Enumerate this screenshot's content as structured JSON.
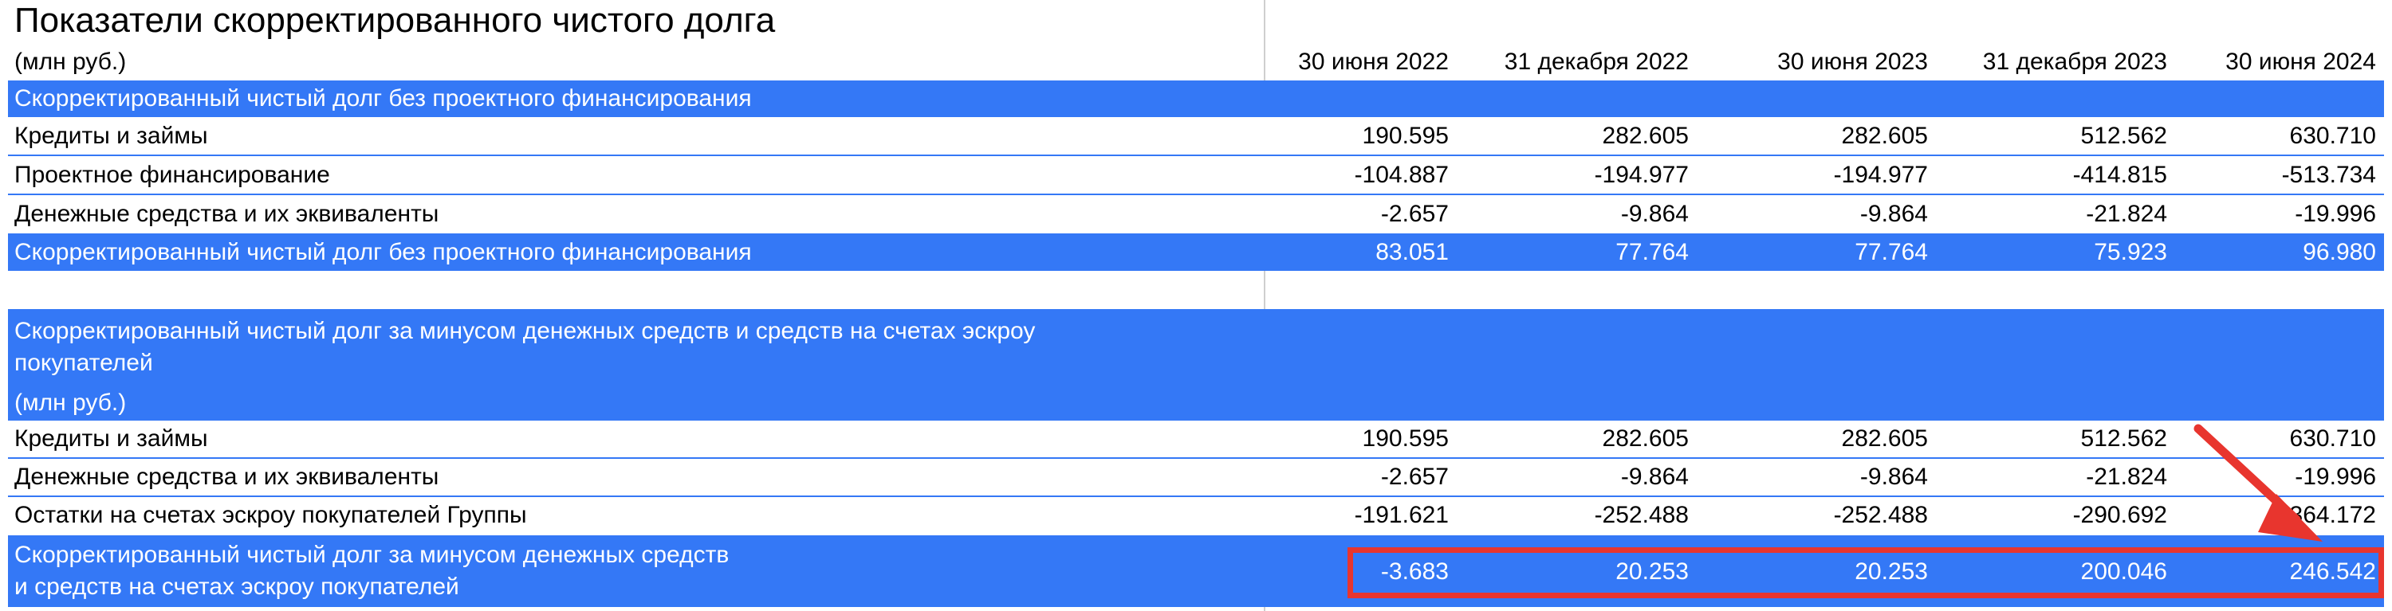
{
  "title": "Показатели скорректированного чистого долга",
  "unit": "(млн руб.)",
  "columns": [
    "30 июня 2022",
    "31 декабря 2022",
    "30 июня 2023",
    "31 декабря 2023",
    "30 июня 2024"
  ],
  "section1": {
    "header": "Скорректированный чистый долг без проектного финансирования",
    "rows": [
      {
        "label": "Кредиты и займы",
        "values": [
          "190.595",
          "282.605",
          "282.605",
          "512.562",
          "630.710"
        ]
      },
      {
        "label": "Проектное финансирование",
        "values": [
          "-104.887",
          "-194.977",
          "-194.977",
          "-414.815",
          "-513.734"
        ]
      },
      {
        "label": "Денежные средства и их эквиваленты",
        "values": [
          "-2.657",
          "-9.864",
          "-9.864",
          "-21.824",
          "-19.996"
        ]
      }
    ],
    "total": {
      "label": "Скорректированный чистый долг без проектного финансирования",
      "values": [
        "83.051",
        "77.764",
        "77.764",
        "75.923",
        "96.980"
      ]
    }
  },
  "section2": {
    "header_line1": "Скорректированный чистый долг за минусом денежных средств и средств на счетах эскроу",
    "header_line2": "покупателей",
    "unit": "(млн руб.)",
    "rows": [
      {
        "label": "Кредиты и займы",
        "values": [
          "190.595",
          "282.605",
          "282.605",
          "512.562",
          "630.710"
        ]
      },
      {
        "label": "Денежные средства и их эквиваленты",
        "values": [
          "-2.657",
          "-9.864",
          "-9.864",
          "-21.824",
          "-19.996"
        ]
      },
      {
        "label": "Остатки на счетах эскроу покупателей Группы",
        "values": [
          "-191.621",
          "-252.488",
          "-252.488",
          "-290.692",
          "-364.172"
        ]
      }
    ],
    "total": {
      "label_line1": "Скорректированный чистый долг за минусом денежных средств",
      "label_line2": "и средств на счетах эскроу покупателей",
      "values": [
        "-3.683",
        "20.253",
        "20.253",
        "200.046",
        "246.542"
      ]
    }
  },
  "colors": {
    "accent_blue": "#3478f6",
    "highlight_red": "#e8352e"
  }
}
